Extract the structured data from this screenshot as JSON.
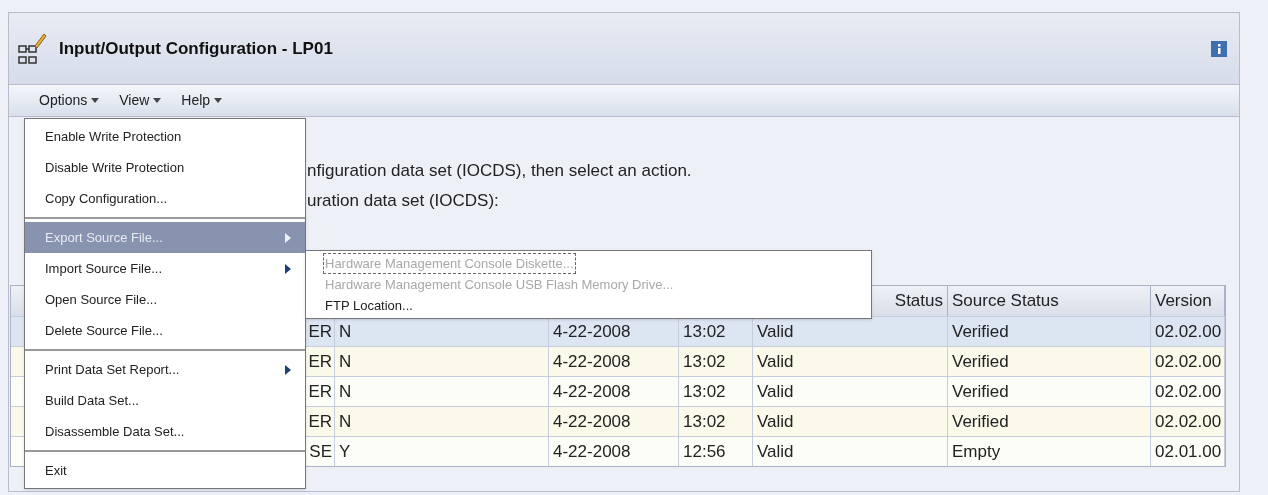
{
  "window": {
    "title": "Input/Output Configuration - LP01"
  },
  "menu_bar": [
    {
      "label": "Options"
    },
    {
      "label": "View"
    },
    {
      "label": "Help"
    }
  ],
  "instructions": [
    "nfiguration data set (IOCDS), then select an action.",
    "uration data set (IOCDS):"
  ],
  "table": {
    "columns": [
      null,
      null,
      null,
      null,
      "Status",
      "Source Status",
      "Version"
    ],
    "rows": [
      {
        "selected": true,
        "cells": [
          "ER",
          "N",
          "4-22-2008",
          "13:02",
          "Valid",
          "Verified",
          "02.02.00"
        ]
      },
      {
        "selected": false,
        "cells": [
          "ER",
          "N",
          "4-22-2008",
          "13:02",
          "Valid",
          "Verified",
          "02.02.00"
        ]
      },
      {
        "selected": false,
        "cells": [
          "ER",
          "N",
          "4-22-2008",
          "13:02",
          "Valid",
          "Verified",
          "02.02.00"
        ]
      },
      {
        "selected": false,
        "cells": [
          "ER",
          "N",
          "4-22-2008",
          "13:02",
          "Valid",
          "Verified",
          "02.02.00"
        ]
      },
      {
        "selected": false,
        "cells": [
          "SE",
          "Y",
          "4-22-2008",
          "12:56",
          "Valid",
          "Empty",
          "02.01.00"
        ]
      }
    ]
  },
  "options_menu": [
    {
      "kind": "item",
      "label": "Enable Write Protection",
      "submenu": false,
      "selected": false
    },
    {
      "kind": "item",
      "label": "Disable Write Protection",
      "submenu": false,
      "selected": false
    },
    {
      "kind": "item",
      "label": "Copy Configuration...",
      "submenu": false,
      "selected": false
    },
    {
      "kind": "separator"
    },
    {
      "kind": "item",
      "label": "Export Source File...",
      "submenu": true,
      "selected": true
    },
    {
      "kind": "item",
      "label": "Import Source File...",
      "submenu": true,
      "selected": false
    },
    {
      "kind": "item",
      "label": "Open Source File...",
      "submenu": false,
      "selected": false
    },
    {
      "kind": "item",
      "label": "Delete Source File...",
      "submenu": false,
      "selected": false
    },
    {
      "kind": "separator"
    },
    {
      "kind": "item",
      "label": "Print Data Set Report...",
      "submenu": true,
      "selected": false
    },
    {
      "kind": "item",
      "label": "Build Data Set...",
      "submenu": false,
      "selected": false
    },
    {
      "kind": "item",
      "label": "Disassemble Data Set...",
      "submenu": false,
      "selected": false
    },
    {
      "kind": "separator"
    },
    {
      "kind": "item",
      "label": "Exit",
      "submenu": false,
      "selected": false
    }
  ],
  "export_submenu": [
    {
      "label": "Hardware Management Console Diskette...",
      "disabled": true,
      "focused": true
    },
    {
      "label": "Hardware Management Console USB Flash Memory Drive...",
      "disabled": true,
      "focused": false
    },
    {
      "label": "FTP Location...",
      "disabled": false,
      "focused": false
    }
  ]
}
